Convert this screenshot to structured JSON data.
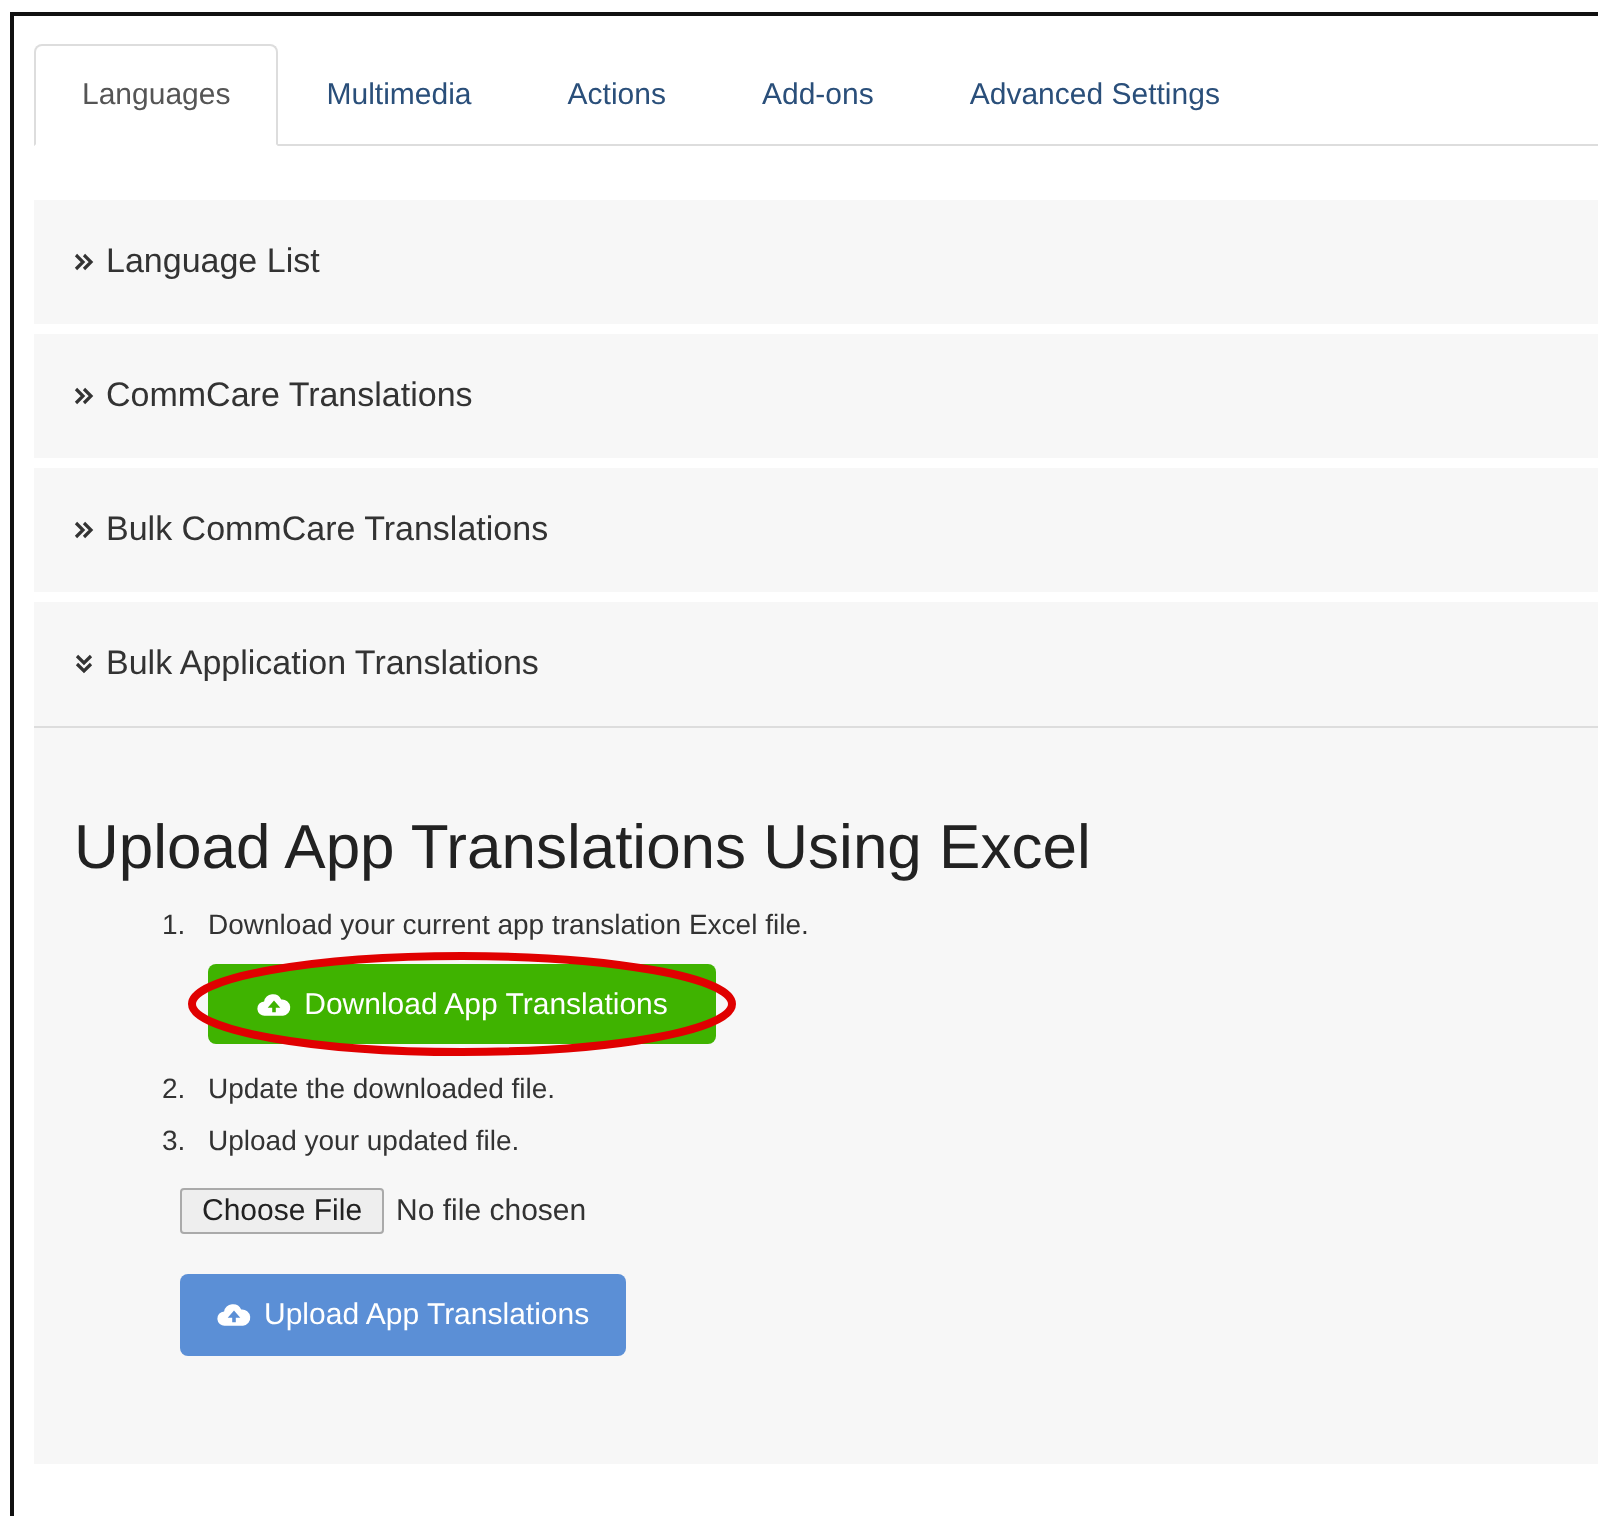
{
  "tabs": [
    {
      "label": "Languages",
      "selected": true
    },
    {
      "label": "Multimedia",
      "selected": false
    },
    {
      "label": "Actions",
      "selected": false
    },
    {
      "label": "Add-ons",
      "selected": false
    },
    {
      "label": "Advanced Settings",
      "selected": false
    }
  ],
  "panels": [
    {
      "title": "Language List",
      "expanded": false
    },
    {
      "title": "CommCare Translations",
      "expanded": false
    },
    {
      "title": "Bulk CommCare Translations",
      "expanded": false
    },
    {
      "title": "Bulk Application Translations",
      "expanded": true
    }
  ],
  "upload_section": {
    "heading": "Upload App Translations Using Excel",
    "steps": [
      {
        "number": "1.",
        "text": "Download your current app translation Excel file.",
        "kind": "download"
      },
      {
        "number": "2.",
        "text": "Update the downloaded file.",
        "kind": "plain"
      },
      {
        "number": "3.",
        "text": "Upload your updated file.",
        "kind": "file"
      }
    ],
    "download_button": {
      "label": "Download App Translations",
      "highlighted": true
    },
    "file_input": {
      "button": "Choose File",
      "status": "No file chosen"
    },
    "upload_button": {
      "label": "Upload App Translations"
    }
  }
}
